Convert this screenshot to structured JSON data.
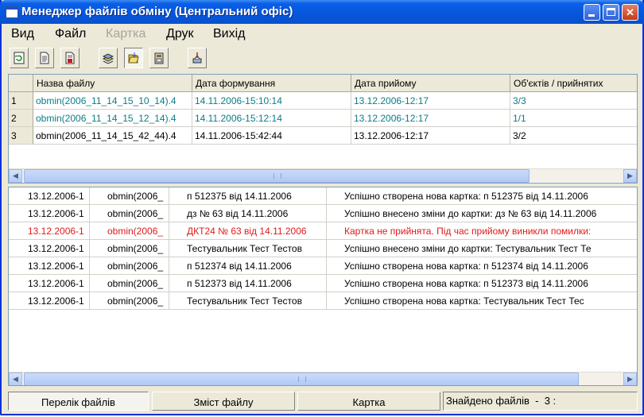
{
  "window": {
    "title": "Менеджер файлів обміну (Центральний офіс)",
    "buttons": [
      "minimize",
      "maximize",
      "close"
    ]
  },
  "menu": [
    {
      "label": "Вид",
      "enabled": true
    },
    {
      "label": "Файл",
      "enabled": true
    },
    {
      "label": "Картка",
      "enabled": false
    },
    {
      "label": "Друк",
      "enabled": true
    },
    {
      "label": "Вихід",
      "enabled": true
    }
  ],
  "toolbar": [
    {
      "icon": "refresh-icon"
    },
    {
      "icon": "document-icon"
    },
    {
      "icon": "document-red-icon"
    },
    {
      "icon": "stack-icon"
    },
    {
      "icon": "folder-open-icon",
      "pressed": true
    },
    {
      "icon": "archive-icon"
    },
    {
      "icon": "export-icon"
    }
  ],
  "files_table": {
    "columns": [
      "Назва файлу",
      "Дата формування",
      "Дата прийому",
      "Об'єктів / прийнятих"
    ],
    "rows": [
      {
        "num": "1",
        "name": "obmin(2006_11_14_15_10_14).4",
        "created": "14.11.2006-15:10:14",
        "received": "13.12.2006-12:17",
        "objects": "3/3",
        "status": "ok"
      },
      {
        "num": "2",
        "name": "obmin(2006_11_14_15_12_14).4",
        "created": "14.11.2006-15:12:14",
        "received": "13.12.2006-12:17",
        "objects": "1/1",
        "status": "ok"
      },
      {
        "num": "3",
        "name": "obmin(2006_11_14_15_42_44).4",
        "created": "14.11.2006-15:42:44",
        "received": "13.12.2006-12:17",
        "objects": "3/2",
        "status": "partial"
      }
    ]
  },
  "log_table": {
    "rows": [
      {
        "date": "13.12.2006-1",
        "file": "obmin(2006_",
        "object": "п 512375 від 14.11.2006",
        "message": "Успішно створена нова картка: п 512375 від 14.11.2006",
        "error": false
      },
      {
        "date": "13.12.2006-1",
        "file": "obmin(2006_",
        "object": "дз № 63 від 14.11.2006",
        "message": "Успішно внесено зміни до картки: дз № 63 від 14.11.2006",
        "error": false
      },
      {
        "date": "13.12.2006-1",
        "file": "obmin(2006_",
        "object": "ДКТ24 № 63 від 14.11.2006",
        "message": "Картка не прийнята. Під час прийому виникли помилки:",
        "error": true
      },
      {
        "date": "13.12.2006-1",
        "file": "obmin(2006_",
        "object": "Тестувальник Тест Тестов",
        "message": "Успішно внесено зміни до картки: Тестувальник Тест Те",
        "error": false
      },
      {
        "date": "13.12.2006-1",
        "file": "obmin(2006_",
        "object": "п 512374 від 14.11.2006",
        "message": "Успішно створена нова картка: п 512374 від 14.11.2006",
        "error": false
      },
      {
        "date": "13.12.2006-1",
        "file": "obmin(2006_",
        "object": "п 512373 від 14.11.2006",
        "message": "Успішно створена нова картка: п 512373 від 14.11.2006",
        "error": false
      },
      {
        "date": "13.12.2006-1",
        "file": "obmin(2006_",
        "object": "Тестувальник Тест Тестов",
        "message": "Успішно створена нова картка: Тестувальник Тест Тес",
        "error": false
      }
    ]
  },
  "status_tabs": [
    {
      "label": "Перелік файлів",
      "active": true
    },
    {
      "label": "Зміст файлу",
      "active": false
    },
    {
      "label": "Картка",
      "active": false
    }
  ],
  "status_info": "Знайдено файлів  -  3 :",
  "colors": {
    "ok_row": "#0c7c85",
    "error_row": "#e01a1a",
    "titlebar": "#0656dc"
  }
}
